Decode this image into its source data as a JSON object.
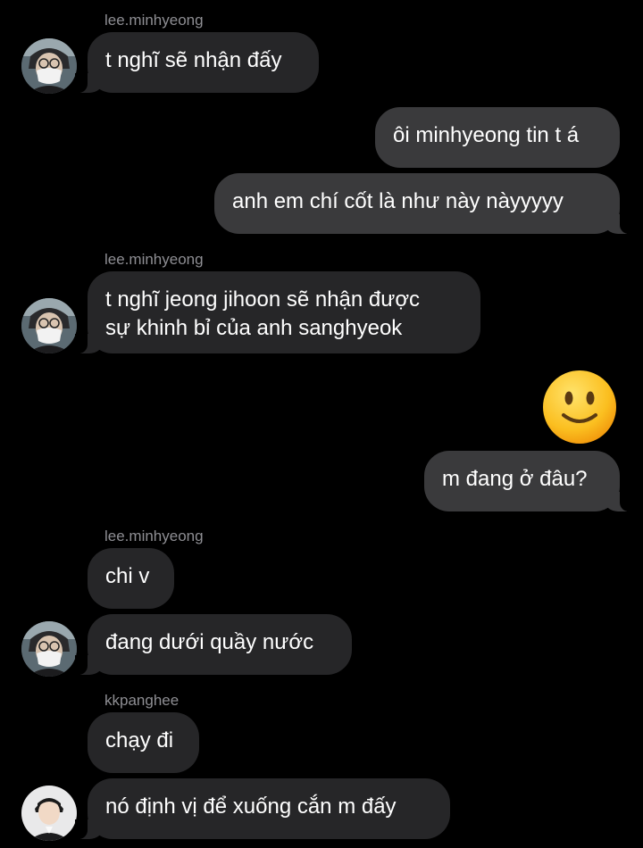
{
  "conversation": {
    "messages": [
      {
        "sender": "lee.minhyeong",
        "text": "t nghĩ sẽ nhận đấy"
      },
      {
        "text": "ôi minhyeong tin t á"
      },
      {
        "text": "anh em chí cốt là như này nàyyyyy"
      },
      {
        "sender": "lee.minhyeong",
        "lines": [
          "t nghĩ jeong jihoon sẽ nhận được",
          "sự khinh bỉ của anh sanghyeok"
        ]
      },
      {
        "emoji": "slightly-smiling-face-icon"
      },
      {
        "text": "m đang ở đâu?"
      },
      {
        "sender": "lee.minhyeong",
        "text": "chi v"
      },
      {
        "text": "đang dưới quầy nước"
      },
      {
        "sender": "kkpanghee",
        "text": "chạy đi"
      },
      {
        "text": "nó định vị để xuống cắn m đấy"
      }
    ]
  },
  "colors": {
    "background": "#000000",
    "incoming_bubble": "#262628",
    "outgoing_bubble": "#3a3a3c",
    "sender_name": "#8e8e93",
    "text": "#ffffff"
  }
}
